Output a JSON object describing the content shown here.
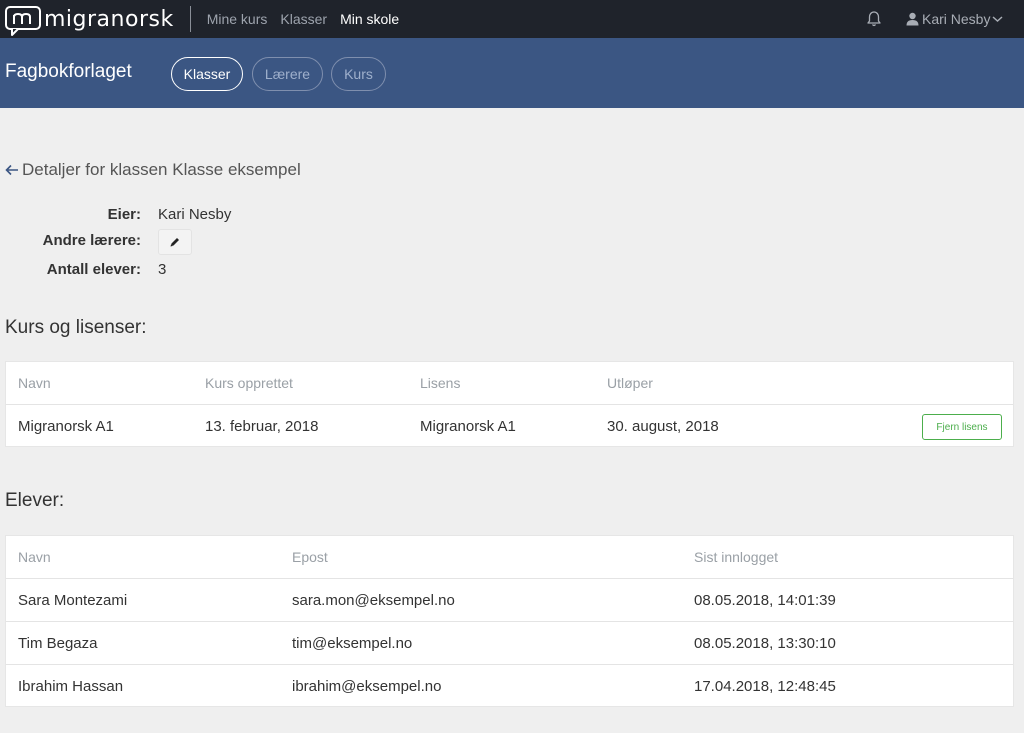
{
  "brand": {
    "name": "migranorsk"
  },
  "nav": {
    "items": [
      {
        "label": "Mine kurs",
        "active": false
      },
      {
        "label": "Klasser",
        "active": false
      },
      {
        "label": "Min skole",
        "active": true
      }
    ],
    "user_name": "Kari Nesby"
  },
  "subheader": {
    "org_name": "Fagbokforlaget",
    "tabs": [
      {
        "label": "Klasser",
        "active": true
      },
      {
        "label": "Lærere",
        "active": false
      },
      {
        "label": "Kurs",
        "active": false
      }
    ]
  },
  "page": {
    "title": "Detaljer for klassen Klasse eksempel"
  },
  "details": {
    "owner_label": "Eier:",
    "owner_value": "Kari Nesby",
    "teachers_label": "Andre lærere:",
    "students_label": "Antall elever:",
    "students_value": "3"
  },
  "courses": {
    "title": "Kurs og lisenser:",
    "headers": [
      "Navn",
      "Kurs opprettet",
      "Lisens",
      "Utløper"
    ],
    "rows": [
      {
        "name": "Migranorsk A1",
        "created": "13. februar, 2018",
        "license": "Migranorsk A1",
        "expires": "30. august, 2018",
        "action": "Fjern lisens"
      }
    ]
  },
  "students": {
    "title": "Elever:",
    "headers": [
      "Navn",
      "Epost",
      "Sist innlogget"
    ],
    "rows": [
      {
        "name": "Sara Montezami",
        "email": "sara.mon@eksempel.no",
        "last_login": "08.05.2018, 14:01:39"
      },
      {
        "name": "Tim Begaza",
        "email": "tim@eksempel.no",
        "last_login": "08.05.2018, 13:30:10"
      },
      {
        "name": "Ibrahim Hassan",
        "email": "ibrahim@eksempel.no",
        "last_login": "17.04.2018, 12:48:45"
      }
    ]
  },
  "colors": {
    "topbar": "#1f232b",
    "subheader": "#3b5683",
    "background": "#efefef",
    "success": "#4cae4c"
  },
  "icons": [
    "logo-icon",
    "bell-icon",
    "user-icon",
    "chevron-down-icon",
    "arrow-left-icon",
    "pencil-icon"
  ]
}
